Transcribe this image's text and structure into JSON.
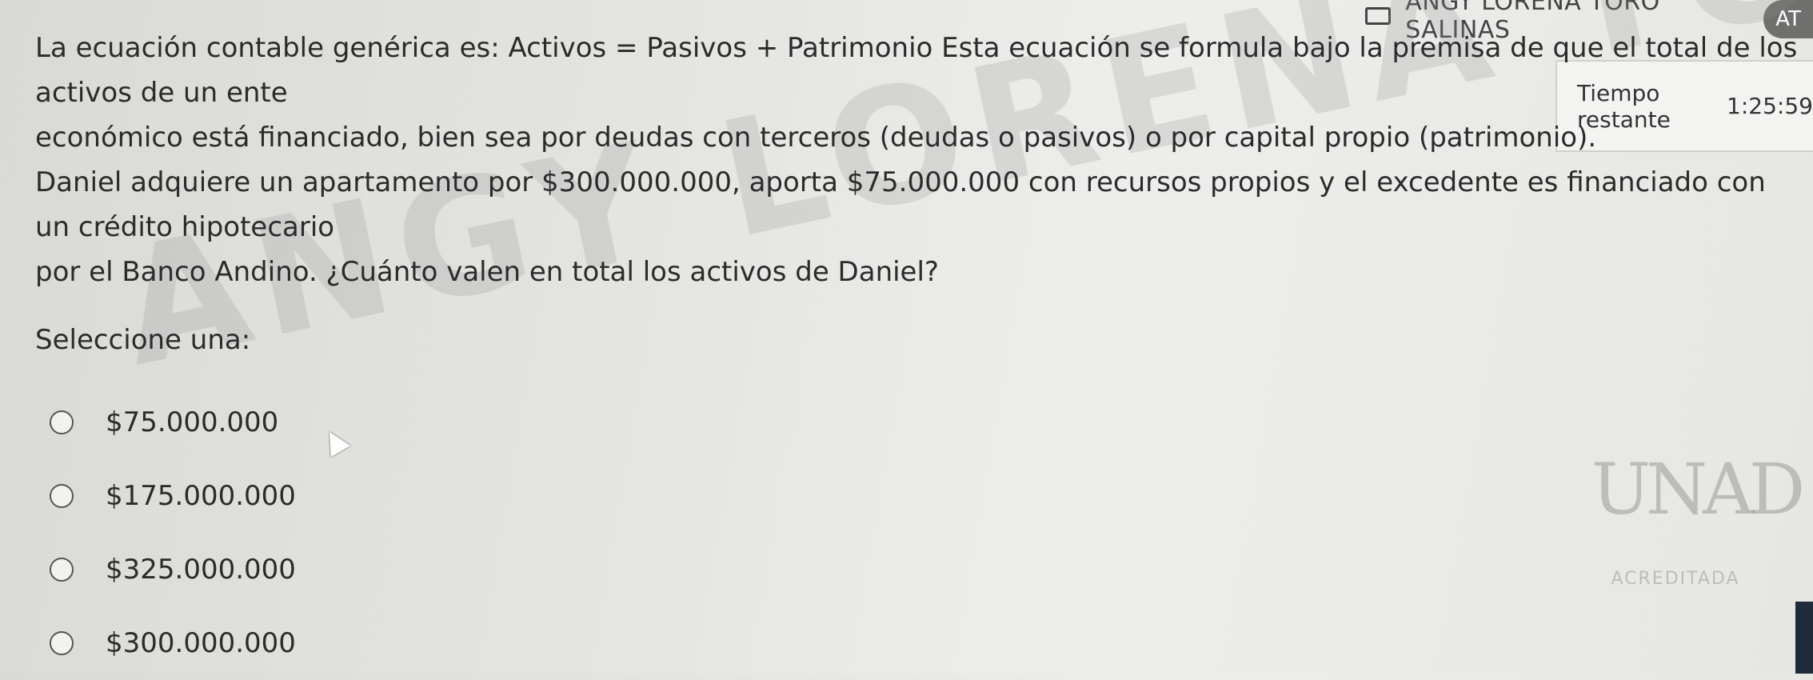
{
  "header": {
    "user_name": "ANGY LORENA TORO SALINAS",
    "avatar_initials": "AT",
    "user_icon": "user-card-icon"
  },
  "timer": {
    "label": "Tiempo restante",
    "value": "1:25:59"
  },
  "question": {
    "line_1": "La ecuación contable genérica es: Activos = Pasivos + Patrimonio Esta ecuación se formula bajo la premisa de que el total de los activos de un ente",
    "line_2": "económico está financiado, bien sea por deudas con terceros (deudas o pasivos) o por capital propio (patrimonio).",
    "line_3": "Daniel adquiere un apartamento por $300.000.000, aporta $75.000.000 con recursos propios y el excedente es financiado con un crédito hipotecario",
    "line_4": "por el Banco Andino.   ¿Cuánto valen en total los activos de Daniel?"
  },
  "watermark": "ANGY LORENA TORO SALINAS",
  "select_label": "Seleccione una:",
  "options": [
    {
      "label": "$75.000.000"
    },
    {
      "label": "$175.000.000"
    },
    {
      "label": "$325.000.000"
    },
    {
      "label": "$300.000.000"
    }
  ],
  "logo": {
    "mark": "UNAD",
    "acred": "ACREDITADA"
  }
}
